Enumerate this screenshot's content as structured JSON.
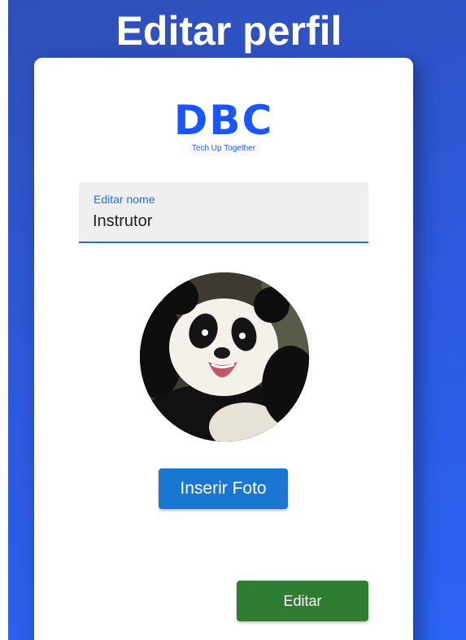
{
  "page": {
    "title": "Editar perfil"
  },
  "logo": {
    "brand": "DBC",
    "tagline": "Tech Up Together"
  },
  "form": {
    "name_label": "Editar nome",
    "name_value": "Instrutor"
  },
  "avatar": {
    "subject": "panda photo"
  },
  "buttons": {
    "insert_photo": "Inserir Foto",
    "edit": "Editar"
  },
  "colors": {
    "background_start": "#2e4fb8",
    "background_end": "#2b63f5",
    "brand_blue": "#1a56ff",
    "primary_button": "#1976d2",
    "success_button": "#2e7d32",
    "field_underline": "#1e6fd6"
  }
}
